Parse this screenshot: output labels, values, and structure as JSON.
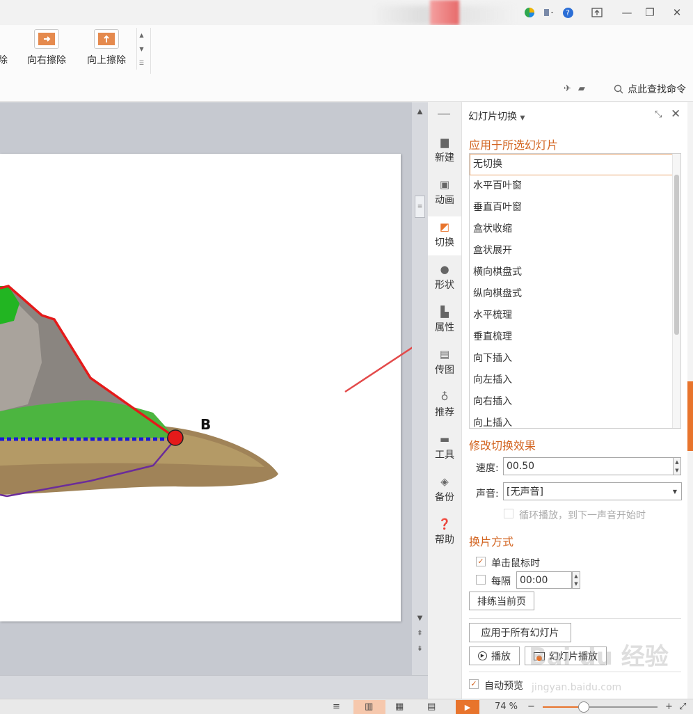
{
  "titlebar": {
    "icons": [
      "wps-logo-icon",
      "skin-icon",
      "help-icon",
      "upload-icon",
      "minimize-icon",
      "restore-icon",
      "close-icon"
    ],
    "help_glyph": "?",
    "minimize_glyph": "—",
    "restore_glyph": "❐",
    "close_glyph": "✕"
  },
  "ribbon": {
    "items": [
      {
        "label": "除"
      },
      {
        "label": "向右擦除"
      },
      {
        "label": "向上擦除"
      }
    ],
    "command_search": "点此查找命令"
  },
  "slide": {
    "point_label": "B"
  },
  "sidebar": {
    "items": [
      {
        "label": "新建",
        "icon": "file-icon"
      },
      {
        "label": "动画",
        "icon": "animation-icon"
      },
      {
        "label": "切换",
        "icon": "transition-icon"
      },
      {
        "label": "形状",
        "icon": "shapes-icon"
      },
      {
        "label": "属性",
        "icon": "properties-icon"
      },
      {
        "label": "传图",
        "icon": "image-upload-icon"
      },
      {
        "label": "推荐",
        "icon": "recommend-icon"
      },
      {
        "label": "工具",
        "icon": "toolbox-icon"
      },
      {
        "label": "备份",
        "icon": "backup-icon"
      },
      {
        "label": "帮助",
        "icon": "help-icon"
      }
    ]
  },
  "panel": {
    "title": "幻灯片切换",
    "apply_section": "应用于所选幻灯片",
    "transitions": [
      "无切换",
      "水平百叶窗",
      "垂直百叶窗",
      "盒状收缩",
      "盒状展开",
      "横向棋盘式",
      "纵向棋盘式",
      "水平梳理",
      "垂直梳理",
      "向下插入",
      "向左插入",
      "向右插入",
      "向上插入"
    ],
    "selected_index": 0,
    "modify_section": "修改切换效果",
    "speed_label": "速度:",
    "speed_value": "00.50",
    "sound_label": "声音:",
    "sound_value": "[无声音]",
    "loop_label": "循环播放，到下一声音开始时",
    "advance_section": "换片方式",
    "on_click_label": "单击鼠标时",
    "on_click_checked": true,
    "every_label": "每隔",
    "every_value": "00:00",
    "every_checked": false,
    "rehearse_button": "排练当前页",
    "apply_all_button": "应用于所有幻灯片",
    "play_button": "播放",
    "slideshow_button": "幻灯片播放",
    "auto_preview_label": "自动预览",
    "auto_preview_checked": true
  },
  "statusbar": {
    "zoom": "74 %",
    "zoom_level": 0.36
  },
  "watermark": {
    "brand": "Bai du 经验",
    "url": "jingyan.baidu.com"
  },
  "colors": {
    "accent": "#d2631f",
    "play": "#e8742c"
  }
}
